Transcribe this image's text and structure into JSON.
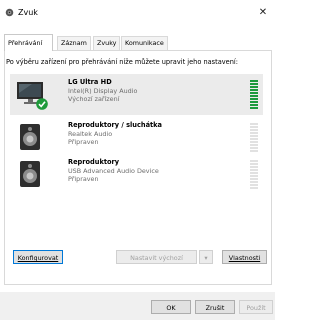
{
  "window": {
    "title": "Zvuk",
    "close_glyph": "✕"
  },
  "tabs": [
    {
      "label": "Přehrávání",
      "active": true
    },
    {
      "label": "Záznam",
      "active": false
    },
    {
      "label": "Zvuky",
      "active": false
    },
    {
      "label": "Komunikace",
      "active": false
    }
  ],
  "instructions": "Po výběru zařízení pro přehrávání níže můžete upravit jeho nastavení:",
  "devices": [
    {
      "name": "LG Ultra HD",
      "driver": "Intel(R) Display Audio",
      "status": "Výchozí zařízení",
      "icon": "monitor-icon",
      "selected": true,
      "default_badge": "check-icon",
      "level_active": true
    },
    {
      "name": "Reproduktory / sluchátka",
      "driver": "Realtek Audio",
      "status": "Připraven",
      "icon": "speaker-icon",
      "selected": false,
      "level_active": false
    },
    {
      "name": "Reproduktory",
      "driver": "USB Advanced Audio Device",
      "status": "Připraven",
      "icon": "speaker-icon",
      "selected": false,
      "level_active": false
    }
  ],
  "buttons": {
    "configure": "Konfigurovat",
    "set_default": "Nastavit výchozí",
    "set_default_arrow": "▾",
    "properties": "Vlastnosti",
    "ok": "OK",
    "cancel": "Zrušit",
    "apply": "Použít"
  },
  "colors": {
    "accent": "#0078d7",
    "level_green": "#1b9a3c",
    "default_check": "#1f9a3b"
  }
}
